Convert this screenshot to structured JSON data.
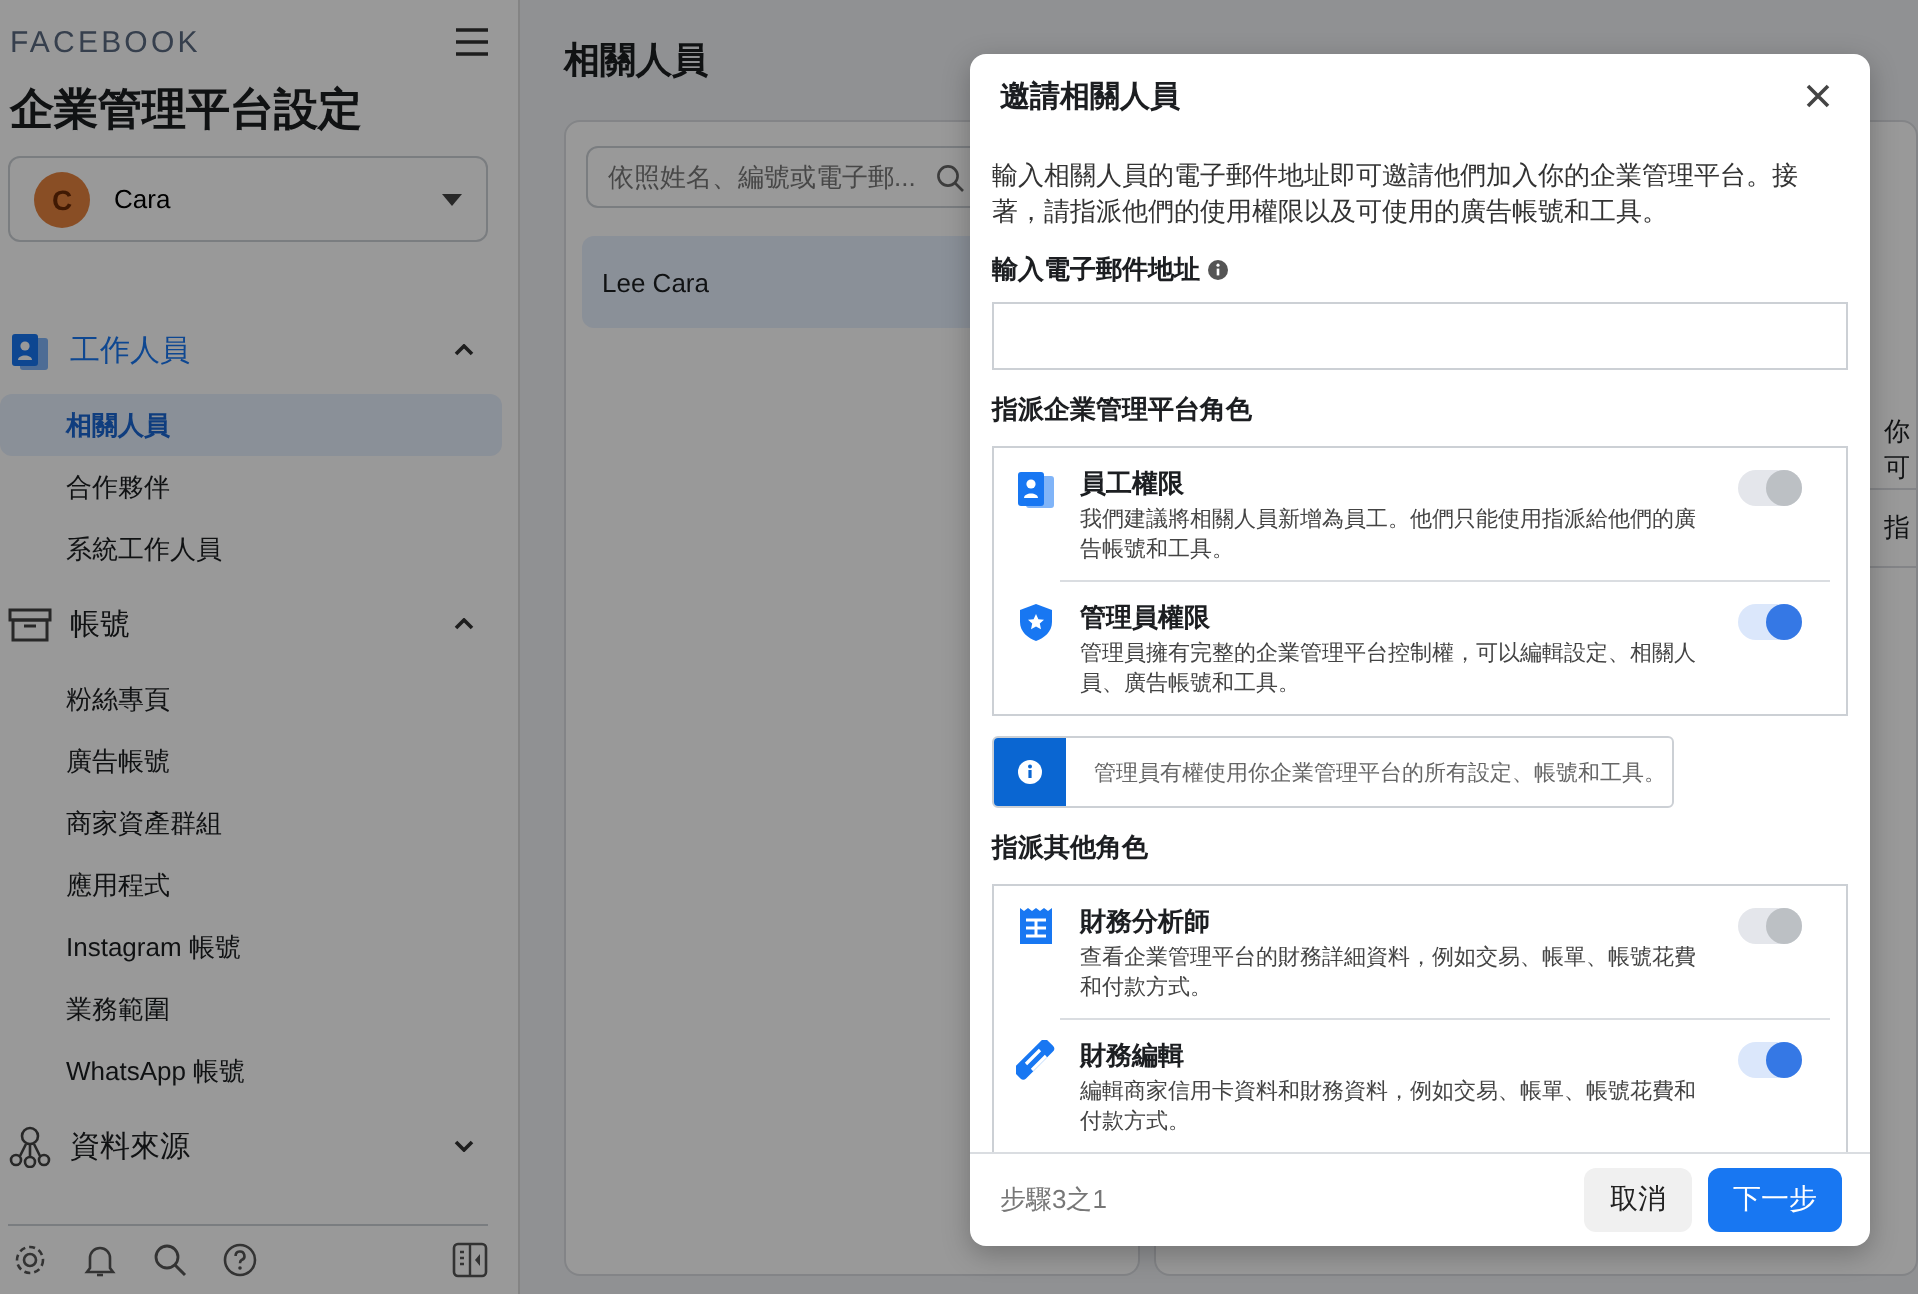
{
  "sidebar": {
    "brand": "FACEBOOK",
    "title": "企業管理平台設定",
    "account": {
      "initial": "C",
      "name": "Cara"
    },
    "sections": [
      {
        "label": "工作人員",
        "selected": true,
        "expanded": true,
        "items": [
          {
            "label": "相關人員",
            "selected": true
          },
          {
            "label": "合作夥伴",
            "selected": false
          },
          {
            "label": "系統工作人員",
            "selected": false
          }
        ]
      },
      {
        "label": "帳號",
        "selected": false,
        "expanded": true,
        "items": [
          {
            "label": "粉絲專頁",
            "selected": false
          },
          {
            "label": "廣告帳號",
            "selected": false
          },
          {
            "label": "商家資產群組",
            "selected": false
          },
          {
            "label": "應用程式",
            "selected": false
          },
          {
            "label": "Instagram 帳號",
            "selected": false
          },
          {
            "label": "業務範圍",
            "selected": false
          },
          {
            "label": "WhatsApp 帳號",
            "selected": false
          }
        ]
      },
      {
        "label": "資料來源",
        "selected": false,
        "expanded": false
      }
    ]
  },
  "main": {
    "title": "相關人員",
    "search": {
      "placeholder": "依照姓名、編號或電子郵..."
    },
    "people": [
      {
        "name": "Lee Cara",
        "selected": true
      }
    ],
    "detail_texts": [
      "你可",
      "指"
    ]
  },
  "dialog": {
    "title": "邀請相關人員",
    "description": "輸入相關人員的電子郵件地址即可邀請他們加入你的企業管理平台。接著，請指派他們的使用權限以及可使用的廣告帳號和工具。",
    "email_label": "輸入電子郵件地址",
    "company_roles_heading": "指派企業管理平台角色",
    "company_roles": [
      {
        "title": "員工權限",
        "description": "我們建議將相關人員新增為員工。他們只能使用指派給他們的廣告帳號和工具。",
        "on": true,
        "disabled": true
      },
      {
        "title": "管理員權限",
        "description": "管理員擁有完整的企業管理平台控制權，可以編輯設定、相關人員、廣告帳號和工具。",
        "on": true,
        "disabled": false
      }
    ],
    "notice": "管理員有權使用你企業管理平台的所有設定、帳號和工具。",
    "other_roles_heading": "指派其他角色",
    "other_roles": [
      {
        "title": "財務分析師",
        "description": "查看企業管理平台的財務詳細資料，例如交易、帳單、帳號花費和付款方式。",
        "on": true,
        "disabled": true
      },
      {
        "title": "財務編輯",
        "description": "編輯商家信用卡資料和財務資料，例如交易、帳單、帳號花費和付款方式。",
        "on": true,
        "disabled": false
      }
    ],
    "step": "步驟3之1",
    "buttons": [
      {
        "label": "取消",
        "kind": "secondary"
      },
      {
        "label": "下一步",
        "kind": "primary"
      }
    ]
  }
}
